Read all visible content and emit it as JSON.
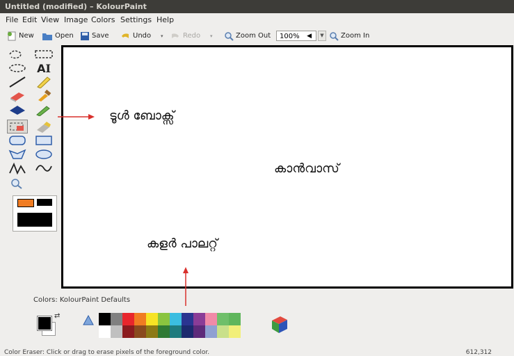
{
  "window": {
    "title": "Untitled (modified) – KolourPaint"
  },
  "menu": [
    "File",
    "Edit",
    "View",
    "Image",
    "Colors",
    "Settings",
    "Help"
  ],
  "toolbar": {
    "new_label": "New",
    "open_label": "Open",
    "save_label": "Save",
    "undo_label": "Undo",
    "redo_label": "Redo",
    "zoom_out_label": "Zoom Out",
    "zoom_value": "100%",
    "zoom_in_label": "Zoom In"
  },
  "annotations": {
    "toolbox": "ടൂൾ ബോക്സ്",
    "canvas": "കാൻവാസ്",
    "palette": "കളർ പാലറ്റ്"
  },
  "palette": {
    "title": "Colors: KolourPaint Defaults",
    "row1": [
      "#000000",
      "#808080",
      "#e8262c",
      "#f07c22",
      "#f6e324",
      "#8ac43f",
      "#3bbde0",
      "#2a3590",
      "#8a3c97",
      "#f08aa8",
      "#6fbf6a",
      "#5fb65c"
    ],
    "row2": [
      "#ffffff",
      "#c0c0c0",
      "#8b1b1f",
      "#8a4a1e",
      "#8c7a16",
      "#2f7a34",
      "#1e7b7e",
      "#1c2a6e",
      "#5d2a7a",
      "#8fa0d2",
      "#c9e08a",
      "#f2ef79"
    ]
  },
  "status": {
    "message": "Color Eraser: Click or drag to erase pixels of the foreground color.",
    "coords": "612,312"
  },
  "colors": {
    "titlebar": "#3d3c38",
    "annotation_arrow": "#d9302c",
    "canvas_border": "#000000"
  }
}
